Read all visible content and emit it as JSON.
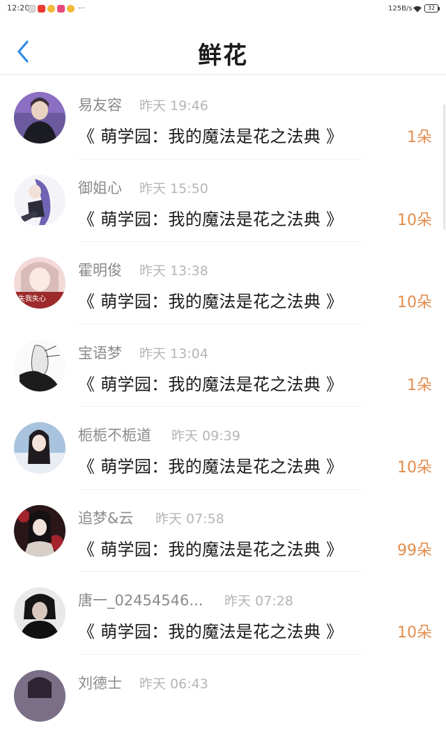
{
  "status_bar": {
    "time": "12:20",
    "notification_icons": [
      "notification-app-icon",
      "notification-app-icon",
      "notification-app-icon",
      "notification-app-icon",
      "notification-app-icon"
    ],
    "more_indicator": "···",
    "network_speed": "125B/s",
    "battery": "32"
  },
  "header": {
    "back_icon": "chevron-left-icon",
    "title": "鲜花",
    "accent_color": "#2f8be6"
  },
  "flower_color": "#e38c4c",
  "items": [
    {
      "name": "易友容",
      "time": "昨天 19:46",
      "book": "《 萌学园：我的魔法是花之法典 》",
      "count": "1朵"
    },
    {
      "name": "御姐心",
      "time": "昨天 15:50",
      "book": "《 萌学园：我的魔法是花之法典 》",
      "count": "10朵"
    },
    {
      "name": "霍明俊",
      "time": "昨天 13:38",
      "book": "《 萌学园：我的魔法是花之法典 》",
      "count": "10朵",
      "avatar_caption": "失我失心"
    },
    {
      "name": "宝语梦",
      "time": "昨天 13:04",
      "book": "《 萌学园：我的魔法是花之法典 》",
      "count": "1朵"
    },
    {
      "name": "栀栀不栀道",
      "time": "昨天 09:39",
      "book": "《 萌学园：我的魔法是花之法典 》",
      "count": "10朵"
    },
    {
      "name": "追梦&云",
      "time": "昨天 07:58",
      "book": "《 萌学园：我的魔法是花之法典 》",
      "count": "99朵"
    },
    {
      "name": "唐一_02454546...",
      "time": "昨天 07:28",
      "book": "《 萌学园：我的魔法是花之法典 》",
      "count": "10朵"
    },
    {
      "name": "刘德士",
      "time": "昨天 06:43",
      "book": "",
      "count": ""
    }
  ]
}
